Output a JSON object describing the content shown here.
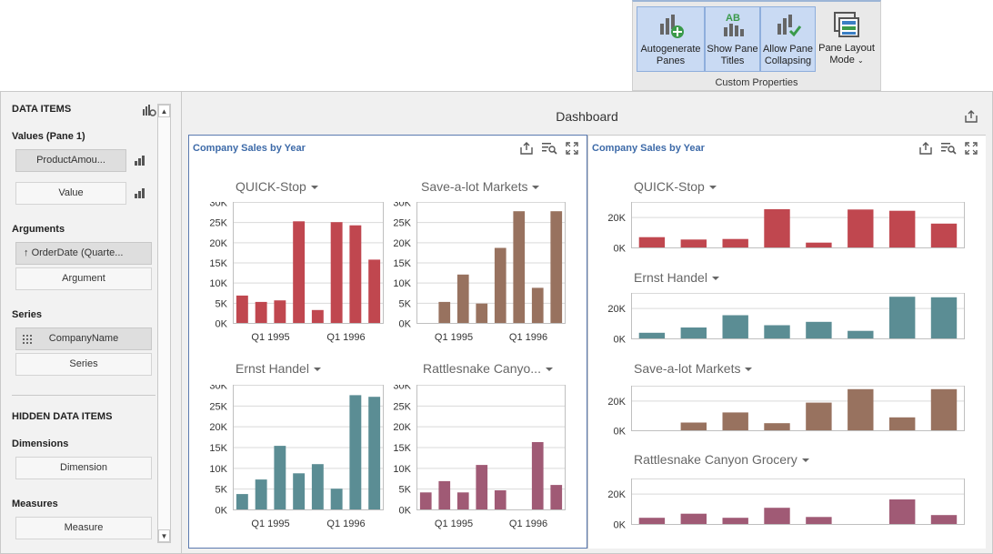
{
  "ribbon": {
    "buttons": [
      {
        "label_1": "Autogenerate",
        "label_2": "Panes",
        "icon": "autogenerate-panes-icon"
      },
      {
        "label_1": "Show Pane",
        "label_2": "Titles",
        "icon": "show-pane-titles-icon"
      },
      {
        "label_1": "Allow Pane",
        "label_2": "Collapsing",
        "icon": "allow-pane-collapsing-icon"
      },
      {
        "label_1": "Pane Layout",
        "label_2": "Mode",
        "icon": "pane-layout-mode-icon"
      }
    ],
    "group_label": "Custom Properties"
  },
  "left_panel": {
    "data_items_title": "DATA ITEMS",
    "values_title": "Values (Pane 1)",
    "values": [
      "ProductAmou...",
      "Value"
    ],
    "arguments_title": "Arguments",
    "arguments": [
      "OrderDate (Quarte...",
      "Argument"
    ],
    "series_title": "Series",
    "series": [
      "CompanyName",
      "Series"
    ],
    "hidden_title": "HIDDEN DATA ITEMS",
    "dimensions_title": "Dimensions",
    "dimensions": [
      "Dimension"
    ],
    "measures_title": "Measures",
    "measures": [
      "Measure"
    ]
  },
  "dashboard": {
    "title": "Dashboard",
    "pane1_title": "Company Sales by Year",
    "pane2_title": "Company Sales by Year"
  },
  "colors": {
    "quick_stop": "#c0474f",
    "save_a_lot": "#98725f",
    "ernst_handel": "#5b8d94",
    "rattlesnake": "#a05a75"
  },
  "chart_data": [
    {
      "type": "bar",
      "title": "QUICK-Stop",
      "x_ticks": [
        "Q1 1995",
        "Q1 1996"
      ],
      "values": [
        6800,
        5200,
        5600,
        25200,
        3200,
        25000,
        24200,
        15700
      ],
      "ylim": [
        0,
        30000
      ],
      "y_ticks": [
        "0K",
        "5K",
        "10K",
        "15K",
        "20K",
        "25K",
        "30K"
      ],
      "color": "#c0474f"
    },
    {
      "type": "bar",
      "title": "Save-a-lot Markets",
      "x_ticks": [
        "Q1 1995",
        "Q1 1996"
      ],
      "values": [
        0,
        5200,
        12000,
        4800,
        18600,
        27700,
        8700,
        27700
      ],
      "ylim": [
        0,
        30000
      ],
      "y_ticks": [
        "0K",
        "5K",
        "10K",
        "15K",
        "20K",
        "25K",
        "30K"
      ],
      "color": "#98725f"
    },
    {
      "type": "bar",
      "title": "Ernst Handel",
      "x_ticks": [
        "Q1 1995",
        "Q1 1996"
      ],
      "values": [
        3700,
        7200,
        15300,
        8700,
        10900,
        5000,
        27500,
        27100
      ],
      "ylim": [
        0,
        30000
      ],
      "y_ticks": [
        "0K",
        "5K",
        "10K",
        "15K",
        "20K",
        "25K",
        "30K"
      ],
      "color": "#5b8d94"
    },
    {
      "type": "bar",
      "title": "Rattlesnake Canyo...",
      "x_ticks": [
        "Q1 1995",
        "Q1 1996"
      ],
      "values": [
        4100,
        6800,
        4100,
        10700,
        4600,
        0,
        16200,
        5900
      ],
      "ylim": [
        0,
        30000
      ],
      "y_ticks": [
        "0K",
        "5K",
        "10K",
        "15K",
        "20K",
        "25K",
        "30K"
      ],
      "color": "#a05a75"
    },
    {
      "type": "bar",
      "title": "QUICK-Stop",
      "values": [
        6800,
        5200,
        5600,
        25200,
        3200,
        25000,
        24200,
        15700
      ],
      "ylim": [
        0,
        30000
      ],
      "y_ticks": [
        "0K",
        "20K"
      ],
      "color": "#c0474f"
    },
    {
      "type": "bar",
      "title": "Ernst Handel",
      "values": [
        3700,
        7200,
        15300,
        8700,
        10900,
        5000,
        27500,
        27100
      ],
      "ylim": [
        0,
        30000
      ],
      "y_ticks": [
        "0K",
        "20K"
      ],
      "color": "#5b8d94"
    },
    {
      "type": "bar",
      "title": "Save-a-lot Markets",
      "values": [
        0,
        5200,
        12000,
        4800,
        18600,
        27700,
        8700,
        27700
      ],
      "ylim": [
        0,
        30000
      ],
      "y_ticks": [
        "0K",
        "20K"
      ],
      "color": "#98725f"
    },
    {
      "type": "bar",
      "title": "Rattlesnake Canyon Grocery",
      "values": [
        4100,
        6800,
        4100,
        10700,
        4600,
        0,
        16200,
        5900
      ],
      "ylim": [
        0,
        30000
      ],
      "y_ticks": [
        "0K",
        "20K"
      ],
      "color": "#a05a75"
    }
  ]
}
